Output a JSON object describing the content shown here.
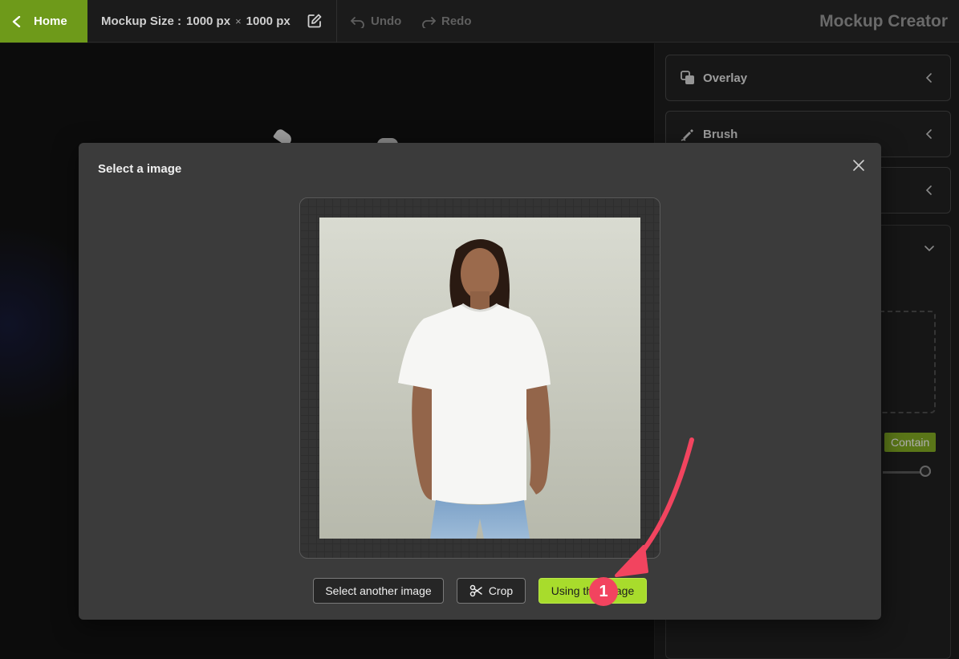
{
  "topbar": {
    "home_label": "Home",
    "size_label": "Mockup Size :",
    "width": "1000 px",
    "times": "×",
    "height": "1000 px",
    "undo_label": "Undo",
    "redo_label": "Redo",
    "app_title": "Mockup Creator"
  },
  "right_panel": {
    "accordions": [
      {
        "label": "Overlay",
        "icon": "layers-icon"
      },
      {
        "label": "Brush",
        "icon": "brush-icon"
      },
      {
        "label": "",
        "icon": ""
      }
    ],
    "fit_mode": "Contain"
  },
  "modal": {
    "title": "Select a image",
    "buttons": {
      "select_another": "Select another image",
      "crop": "Crop",
      "use": "Using this image"
    }
  },
  "annotation": {
    "step_number": "1",
    "color": "#f2445f"
  },
  "colors": {
    "brand_green": "#6e9a1a",
    "primary_button": "#a8dc2c"
  }
}
